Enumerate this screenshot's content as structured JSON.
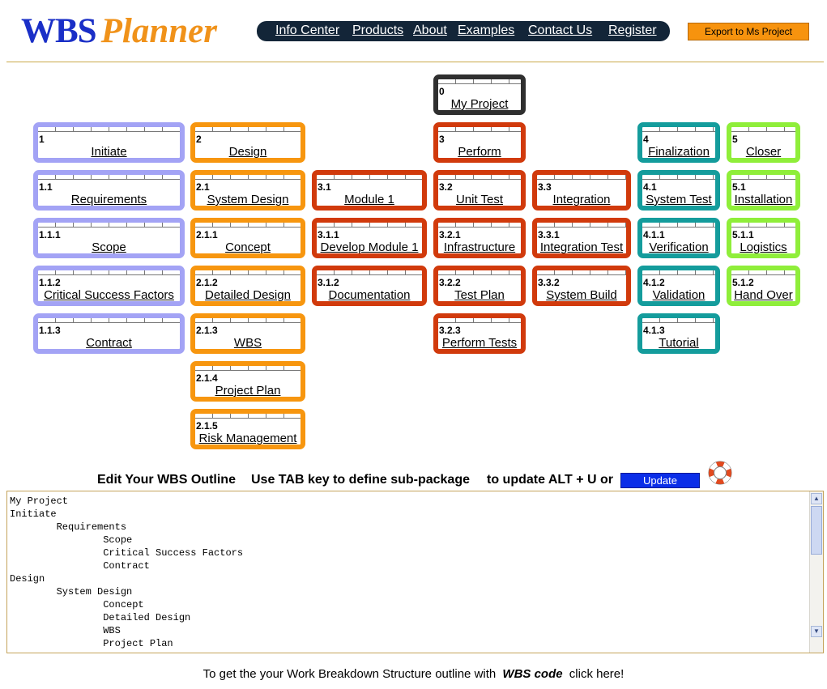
{
  "header": {
    "logo_wbs": "WBS",
    "logo_planner": "Planner",
    "nav": [
      "Info Center",
      "Products",
      "About",
      "Examples",
      "Contact Us",
      "Register"
    ],
    "export_label": "Export to Ms Project"
  },
  "wbs": {
    "root": {
      "code": "0",
      "label": "My Project"
    },
    "n1": {
      "code": "1",
      "label": "Initiate"
    },
    "n1_1": {
      "code": "1.1",
      "label": "Requirements"
    },
    "n1_1_1": {
      "code": "1.1.1",
      "label": "Scope"
    },
    "n1_1_2": {
      "code": "1.1.2",
      "label": "Critical Success Factors"
    },
    "n1_1_3": {
      "code": "1.1.3",
      "label": "Contract"
    },
    "n2": {
      "code": "2",
      "label": "Design"
    },
    "n2_1": {
      "code": "2.1",
      "label": "System Design"
    },
    "n2_1_1": {
      "code": "2.1.1",
      "label": "Concept"
    },
    "n2_1_2": {
      "code": "2.1.2",
      "label": "Detailed Design"
    },
    "n2_1_3": {
      "code": "2.1.3",
      "label": "WBS"
    },
    "n2_1_4": {
      "code": "2.1.4",
      "label": "Project Plan"
    },
    "n2_1_5": {
      "code": "2.1.5",
      "label": "Risk Management"
    },
    "n3": {
      "code": "3",
      "label": "Perform"
    },
    "n3_1": {
      "code": "3.1",
      "label": "Module 1"
    },
    "n3_1_1": {
      "code": "3.1.1",
      "label": "Develop Module 1"
    },
    "n3_1_2": {
      "code": "3.1.2",
      "label": "Documentation"
    },
    "n3_2": {
      "code": "3.2",
      "label": "Unit Test"
    },
    "n3_2_1": {
      "code": "3.2.1",
      "label": "Infrastructure"
    },
    "n3_2_2": {
      "code": "3.2.2",
      "label": "Test Plan"
    },
    "n3_2_3": {
      "code": "3.2.3",
      "label": "Perform Tests"
    },
    "n3_3": {
      "code": "3.3",
      "label": "Integration"
    },
    "n3_3_1": {
      "code": "3.3.1",
      "label": "Integration Test"
    },
    "n3_3_2": {
      "code": "3.3.2",
      "label": "System Build"
    },
    "n4": {
      "code": "4",
      "label": "Finalization"
    },
    "n4_1": {
      "code": "4.1",
      "label": "System Test"
    },
    "n4_1_1": {
      "code": "4.1.1",
      "label": "Verification"
    },
    "n4_1_2": {
      "code": "4.1.2",
      "label": "Validation"
    },
    "n4_1_3": {
      "code": "4.1.3",
      "label": "Tutorial"
    },
    "n5": {
      "code": "5",
      "label": "Closer"
    },
    "n5_1": {
      "code": "5.1",
      "label": "Installation"
    },
    "n5_1_1": {
      "code": "5.1.1",
      "label": "Logistics"
    },
    "n5_1_2": {
      "code": "5.1.2",
      "label": "Hand Over"
    }
  },
  "edit": {
    "title": "Edit Your WBS Outline",
    "hint": "Use TAB key to define sub-package",
    "update_hint": "to update ALT + U or",
    "update_label": "Update",
    "outline_text": "My Project\nInitiate\n\tRequirements\n\t\tScope\n\t\tCritical Success Factors\n\t\tContract\nDesign\n\tSystem Design\n\t\tConcept\n\t\tDetailed Design\n\t\tWBS\n\t\tProject Plan"
  },
  "footer": {
    "prefix": "To get the your Work Breakdown Structure outline with",
    "emphasis": "WBS code",
    "link": "click here!"
  },
  "colors": {
    "root": "#2f2f2f",
    "initiate": "#a3a3f5",
    "design": "#f7960f",
    "perform": "#d13a0c",
    "finalization": "#149c9c",
    "closer": "#8fee3a",
    "nav_bg": "#132538",
    "export_bg": "#f7930e",
    "update_bg": "#0b2ee8"
  },
  "icons": {
    "help": "life-ring-icon"
  }
}
